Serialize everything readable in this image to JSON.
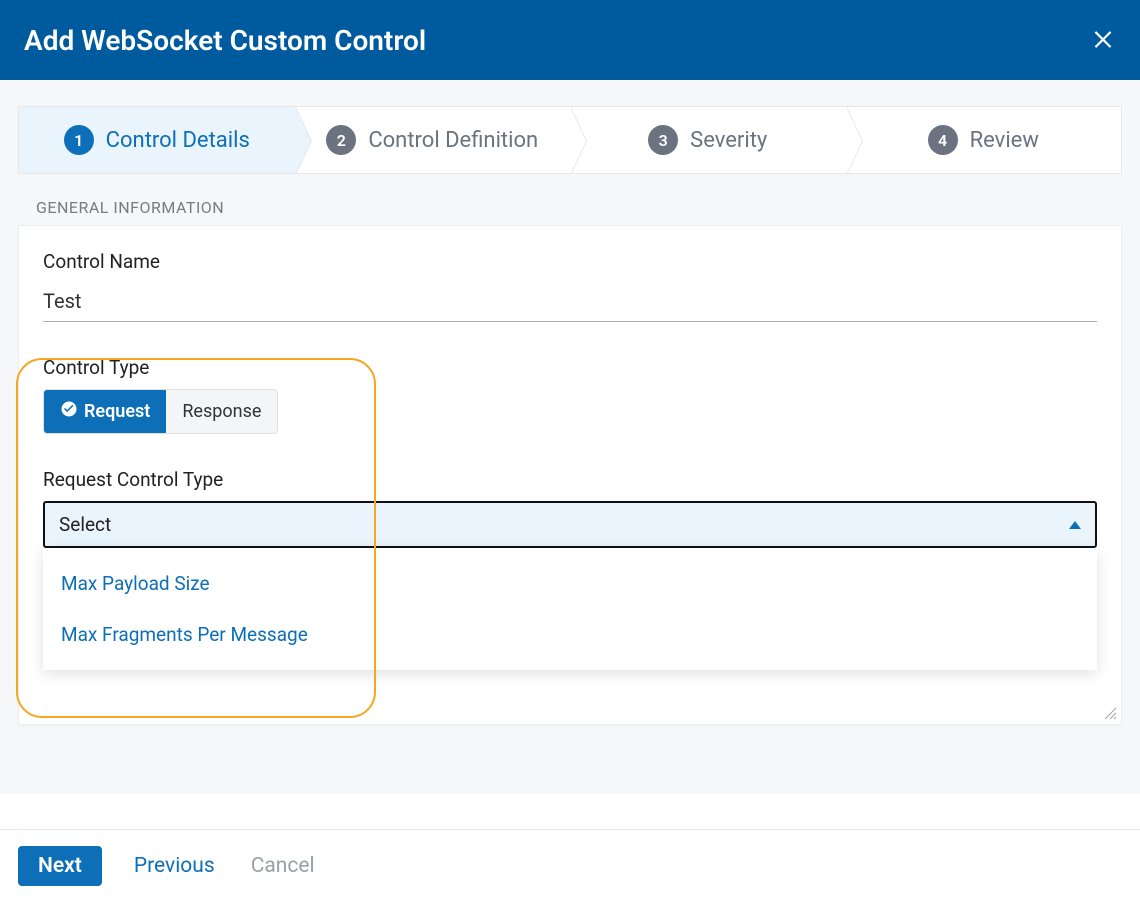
{
  "header": {
    "title": "Add WebSocket Custom Control"
  },
  "steps": [
    {
      "num": "1",
      "label": "Control Details",
      "active": true
    },
    {
      "num": "2",
      "label": "Control Definition",
      "active": false
    },
    {
      "num": "3",
      "label": "Severity",
      "active": false
    },
    {
      "num": "4",
      "label": "Review",
      "active": false
    }
  ],
  "section_heading": "GENERAL INFORMATION",
  "form": {
    "control_name_label": "Control Name",
    "control_name_value": "Test",
    "control_type_label": "Control Type",
    "control_type_options": {
      "request": "Request",
      "response": "Response"
    },
    "request_control_type_label": "Request Control Type",
    "select_placeholder": "Select",
    "dropdown_options": [
      "Max Payload Size",
      "Max Fragments Per Message"
    ]
  },
  "footer": {
    "next": "Next",
    "previous": "Previous",
    "cancel": "Cancel"
  }
}
